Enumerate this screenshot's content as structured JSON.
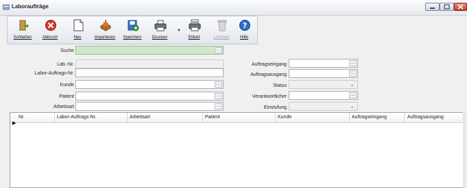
{
  "window": {
    "title": "Laboraufträge"
  },
  "toolbar": {
    "buttons": [
      {
        "label": "Schließen",
        "icon": "close-door-icon"
      },
      {
        "label": "Abbruch",
        "icon": "cancel-icon"
      },
      {
        "label": "Neu",
        "icon": "new-document-icon"
      },
      {
        "label": "Importieren",
        "icon": "import-icon"
      },
      {
        "label": "Speichern",
        "icon": "save-icon"
      },
      {
        "label": "Drucken",
        "icon": "printer-icon"
      },
      {
        "label": "Etikett",
        "icon": "label-printer-icon"
      },
      {
        "label": "Löschen",
        "icon": "delete-icon"
      },
      {
        "label": "Hilfe",
        "icon": "help-icon"
      }
    ]
  },
  "search": {
    "label": "Suche",
    "value": "",
    "ellipsis": "..."
  },
  "form": {
    "left": [
      {
        "label": "Lab.-Nr.",
        "value": ""
      },
      {
        "label": "Labor-Auftrags-Nr.",
        "value": ""
      },
      {
        "label": "Kunde",
        "value": ""
      },
      {
        "label": "Patient",
        "value": ""
      },
      {
        "label": "Arbeitsart",
        "value": ""
      }
    ],
    "right": [
      {
        "label": "Auftragseingang",
        "value": ""
      },
      {
        "label": "Auftragsausgang",
        "value": ""
      },
      {
        "label": "Status",
        "value": ""
      },
      {
        "label": "Verantwortlicher",
        "value": ""
      },
      {
        "label": "Einstufung",
        "value": ""
      }
    ],
    "ellipsis": "...",
    "chevron": "⌄"
  },
  "grid": {
    "columns": [
      "Nr.",
      "Labor-Auftrags-Nr.",
      "Arbeitsart",
      "Patient",
      "Kunde",
      "Auftragseingang",
      "Auftragsausgang"
    ],
    "rows": [],
    "row_pointer": "▶"
  },
  "colors": {
    "search_bg": "#cfe8c8",
    "close_button": "#c1402a"
  }
}
